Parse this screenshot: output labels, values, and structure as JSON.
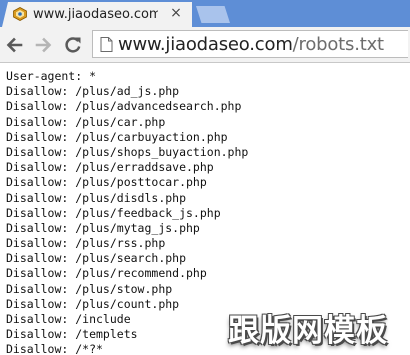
{
  "browser": {
    "tab": {
      "title": "www.jiaodaseo.com/robots.txt",
      "favicon": "site-favicon-icon",
      "close_label": "×"
    },
    "toolbar": {
      "back_icon": "back-arrow-icon",
      "forward_icon": "forward-arrow-icon",
      "reload_icon": "reload-icon"
    },
    "address_bar": {
      "host": "www.jiaodaseo.com",
      "path": "/robots.txt",
      "page_icon": "page-icon"
    }
  },
  "document": {
    "lines": [
      "User-agent: *",
      "Disallow: /plus/ad_js.php",
      "Disallow: /plus/advancedsearch.php",
      "Disallow: /plus/car.php",
      "Disallow: /plus/carbuyaction.php",
      "Disallow: /plus/shops_buyaction.php",
      "Disallow: /plus/erraddsave.php",
      "Disallow: /plus/posttocar.php",
      "Disallow: /plus/disdls.php",
      "Disallow: /plus/feedback_js.php",
      "Disallow: /plus/mytag_js.php",
      "Disallow: /plus/rss.php",
      "Disallow: /plus/search.php",
      "Disallow: /plus/recommend.php",
      "Disallow: /plus/stow.php",
      "Disallow: /plus/count.php",
      "Disallow: /include",
      "Disallow: /templets",
      "Disallow: /*?*"
    ]
  },
  "watermark": {
    "text": "跟版网模板"
  },
  "colors": {
    "tabstrip": "#5e8ed6",
    "tab": "#f2f2f2",
    "toolbar": "#f2f2f2",
    "text": "#111111"
  }
}
